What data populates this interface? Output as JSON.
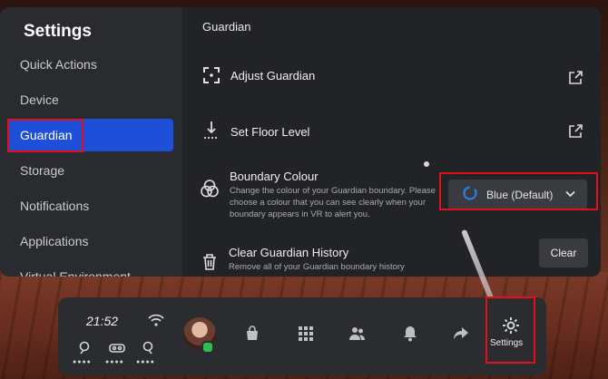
{
  "sidebar": {
    "title": "Settings",
    "items": [
      {
        "label": "Quick Actions"
      },
      {
        "label": "Device"
      },
      {
        "label": "Guardian"
      },
      {
        "label": "Storage"
      },
      {
        "label": "Notifications"
      },
      {
        "label": "Applications"
      },
      {
        "label": "Virtual Environment"
      }
    ],
    "active_index": 2
  },
  "content": {
    "title": "Guardian",
    "adjust_guardian": {
      "label": "Adjust Guardian",
      "icon": "guardian-corners-icon",
      "action_icon": "external-link-icon"
    },
    "set_floor_level": {
      "label": "Set Floor Level",
      "icon": "floor-level-icon",
      "action_icon": "external-link-icon"
    },
    "boundary_colour": {
      "label": "Boundary Colour",
      "description": "Change the colour of your Guardian boundary. Please choose a colour that you can see clearly when your boundary appears in VR to alert you.",
      "icon": "colour-circles-icon",
      "selected": "Blue (Default)",
      "swatch_color": "#2f7fe6"
    },
    "clear_history": {
      "label": "Clear Guardian History",
      "description": "Remove all of your Guardian boundary history",
      "icon": "trash-icon",
      "button": "Clear"
    }
  },
  "taskbar": {
    "time": "21:52",
    "wifi_icon": "wifi-icon",
    "quick_icons": [
      "guardian-icon",
      "passthrough-icon",
      "controller-icon"
    ],
    "apps": [
      {
        "name": "profile",
        "icon": "avatar"
      },
      {
        "name": "store",
        "icon": "store-bag-icon"
      },
      {
        "name": "library",
        "icon": "apps-grid-icon"
      },
      {
        "name": "people",
        "icon": "people-icon"
      },
      {
        "name": "notifications",
        "icon": "bell-icon"
      },
      {
        "name": "share",
        "icon": "share-icon"
      },
      {
        "name": "settings",
        "icon": "gear-icon",
        "label": "Settings"
      }
    ]
  },
  "colors": {
    "accent": "#1d4fd8",
    "highlight": "#e3101b",
    "online": "#2ebd4e"
  }
}
